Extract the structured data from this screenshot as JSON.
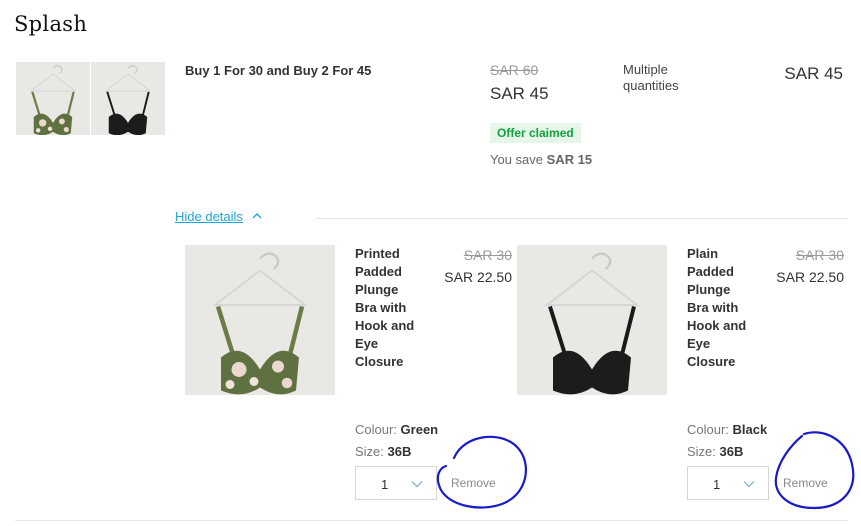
{
  "brand": "Splash",
  "bundle": {
    "title": "Buy 1 For 30 and Buy 2 For 45",
    "old_price": "SAR 60",
    "new_price": "SAR 45",
    "offer_badge": "Offer claimed",
    "save_prefix": "You save",
    "save_amount": "SAR 15",
    "quantity_note": "Multiple quantities",
    "total": "SAR 45",
    "hide_details": "Hide details"
  },
  "items": [
    {
      "name": "Printed Padded Plunge Bra with Hook and Eye Closure",
      "old_price": "SAR 30",
      "new_price": "SAR 22.50",
      "colour_label": "Colour:",
      "colour_value": "Green",
      "size_label": "Size:",
      "size_value": "36B",
      "quantity": "1",
      "remove_label": "Remove",
      "color": "#6b7d45"
    },
    {
      "name": "Plain Padded Plunge Bra with Hook and Eye Closure",
      "old_price": "SAR 30",
      "new_price": "SAR 22.50",
      "colour_label": "Colour:",
      "colour_value": "Black",
      "size_label": "Size:",
      "size_value": "36B",
      "quantity": "1",
      "remove_label": "Remove",
      "color": "#1a1a1a"
    }
  ],
  "colors": {
    "link": "#1ea5d8",
    "badge_bg": "#e6f6ea",
    "badge_text": "#13a13d",
    "annotation": "#1a1ac8"
  }
}
